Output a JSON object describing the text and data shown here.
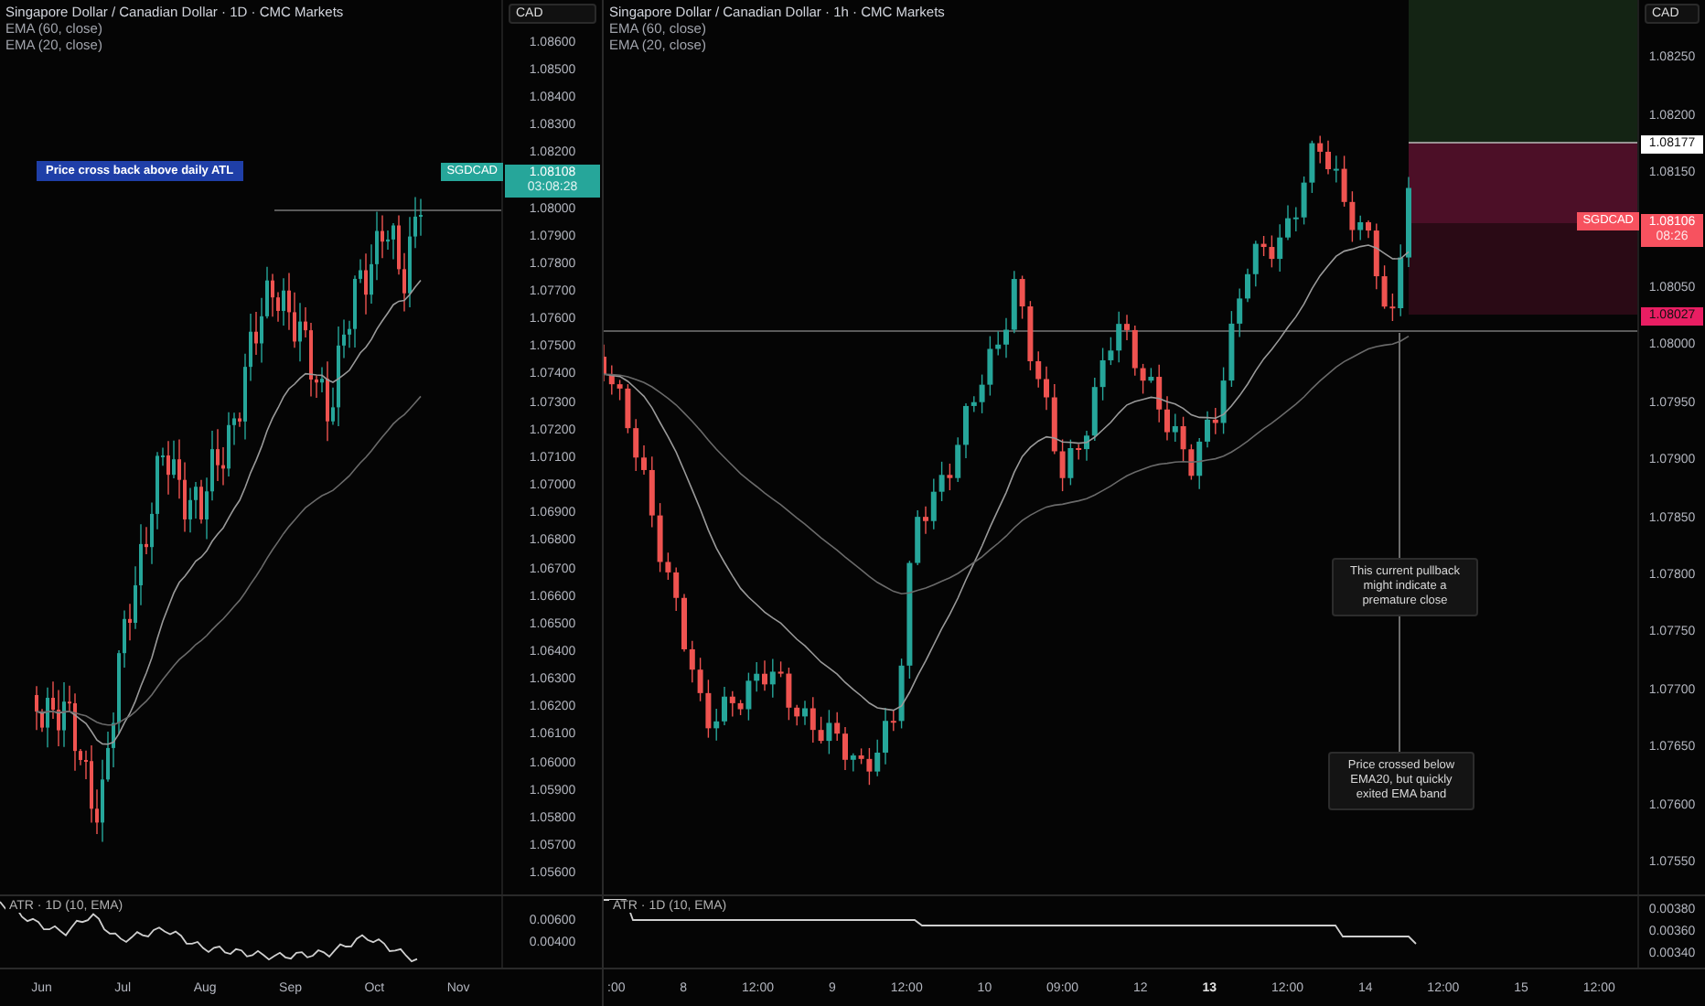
{
  "panels": [
    {
      "title": "Singapore Dollar / Canadian Dollar · 1D · CMC Markets",
      "indicators": [
        "EMA (60, close)",
        "EMA (20, close)"
      ],
      "currency": "CAD",
      "price_scale": [
        {
          "kind": "tick",
          "label": "1.08600"
        },
        {
          "kind": "tick",
          "label": "1.08500"
        },
        {
          "kind": "tick",
          "label": "1.08400"
        },
        {
          "kind": "tick",
          "label": "1.08300"
        },
        {
          "kind": "tick",
          "label": "1.08200"
        },
        {
          "kind": "tag",
          "symbol": "SGDCAD",
          "price": "1.08108",
          "countdown": "03:08:28",
          "color": "#26a69a"
        },
        {
          "kind": "tick",
          "label": "1.08000"
        },
        {
          "kind": "tick",
          "label": "1.07900"
        },
        {
          "kind": "tick",
          "label": "1.07800"
        },
        {
          "kind": "tick",
          "label": "1.07700"
        },
        {
          "kind": "tick",
          "label": "1.07600"
        },
        {
          "kind": "tick",
          "label": "1.07500"
        },
        {
          "kind": "tick",
          "label": "1.07400"
        },
        {
          "kind": "tick",
          "label": "1.07300"
        },
        {
          "kind": "tick",
          "label": "1.07200"
        },
        {
          "kind": "tick",
          "label": "1.07100"
        },
        {
          "kind": "tick",
          "label": "1.07000"
        },
        {
          "kind": "tick",
          "label": "1.06900"
        },
        {
          "kind": "tick",
          "label": "1.06800"
        },
        {
          "kind": "tick",
          "label": "1.06700"
        },
        {
          "kind": "tick",
          "label": "1.06600"
        },
        {
          "kind": "tick",
          "label": "1.06500"
        },
        {
          "kind": "tick",
          "label": "1.06400"
        },
        {
          "kind": "tick",
          "label": "1.06300"
        },
        {
          "kind": "tick",
          "label": "1.06200"
        },
        {
          "kind": "tick",
          "label": "1.06100"
        },
        {
          "kind": "tick",
          "label": "1.06000"
        },
        {
          "kind": "tick",
          "label": "1.05900"
        },
        {
          "kind": "tick",
          "label": "1.05800"
        },
        {
          "kind": "tick",
          "label": "1.05700"
        },
        {
          "kind": "tick",
          "label": "1.05600"
        }
      ],
      "notes": [
        {
          "kind": "banner",
          "text": "Price cross back above daily ATL"
        }
      ],
      "atr": {
        "label": "ATR · 1D (10, EMA)",
        "ticks": [
          "0.00600",
          "0.00400"
        ]
      },
      "time_ticks": [
        {
          "label": "Jun",
          "bold": false
        },
        {
          "label": "Jul",
          "bold": false
        },
        {
          "label": "Aug",
          "bold": false
        },
        {
          "label": "Sep",
          "bold": false
        },
        {
          "label": "Oct",
          "bold": false
        },
        {
          "label": "Nov",
          "bold": false
        }
      ]
    },
    {
      "title": "Singapore Dollar / Canadian Dollar · 1h · CMC Markets",
      "indicators": [
        "EMA (60, close)",
        "EMA (20, close)"
      ],
      "currency": "CAD",
      "price_scale": [
        {
          "kind": "tick",
          "label": "1.08250"
        },
        {
          "kind": "tick",
          "label": "1.08200"
        },
        {
          "kind": "level",
          "label": "1.08177",
          "color": "#ffffff"
        },
        {
          "kind": "tick",
          "label": "1.08150"
        },
        {
          "kind": "tag",
          "symbol": "SGDCAD",
          "price": "1.08106",
          "countdown": "08:26",
          "color": "#f7525f"
        },
        {
          "kind": "tick",
          "label": "1.08050"
        },
        {
          "kind": "level",
          "label": "1.08027",
          "color": "#e91e63"
        },
        {
          "kind": "tick",
          "label": "1.08000"
        },
        {
          "kind": "tick",
          "label": "1.07950"
        },
        {
          "kind": "tick",
          "label": "1.07900"
        },
        {
          "kind": "tick",
          "label": "1.07850"
        },
        {
          "kind": "tick",
          "label": "1.07800"
        },
        {
          "kind": "tick",
          "label": "1.07750"
        },
        {
          "kind": "tick",
          "label": "1.07700"
        },
        {
          "kind": "tick",
          "label": "1.07650"
        },
        {
          "kind": "tick",
          "label": "1.07600"
        },
        {
          "kind": "tick",
          "label": "1.07550"
        }
      ],
      "notes": [
        {
          "kind": "callout",
          "text": "This current pullback might indicate a premature close"
        },
        {
          "kind": "callout",
          "text": "Price crossed below EMA20, but quickly exited EMA band"
        }
      ],
      "atr": {
        "label": "ATR · 1D (10, EMA)",
        "ticks": [
          "0.00380",
          "0.00360",
          "0.00340"
        ]
      },
      "time_ticks": [
        {
          "label": ":00",
          "bold": false
        },
        {
          "label": "8",
          "bold": false
        },
        {
          "label": "12:00",
          "bold": false
        },
        {
          "label": "9",
          "bold": false
        },
        {
          "label": "12:00",
          "bold": false
        },
        {
          "label": "10",
          "bold": false
        },
        {
          "label": "09:00",
          "bold": false
        },
        {
          "label": "12",
          "bold": false
        },
        {
          "label": "13",
          "bold": true
        },
        {
          "label": "12:00",
          "bold": false
        },
        {
          "label": "14",
          "bold": false
        },
        {
          "label": "12:00",
          "bold": false
        },
        {
          "label": "15",
          "bold": false
        },
        {
          "label": "12:00",
          "bold": false
        }
      ]
    }
  ]
}
